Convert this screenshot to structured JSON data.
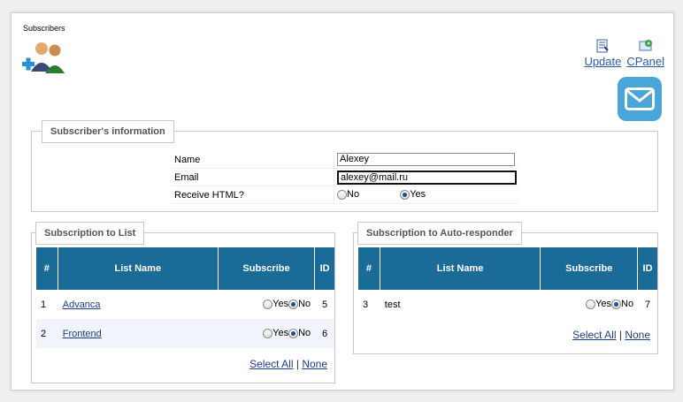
{
  "page": {
    "title": "Subscribers"
  },
  "toolbar": {
    "update_label": "Update",
    "cpanel_label": "CPanel"
  },
  "info": {
    "legend": "Subscriber's information",
    "name_label": "Name",
    "name_value": "Alexey",
    "email_label": "Email",
    "email_value": "alexey@mail.ru",
    "html_label": "Receive HTML?",
    "no_label": "No",
    "yes_label": "Yes",
    "html_selected": "Yes"
  },
  "lists": {
    "legend": "Subscription to List",
    "headers": [
      "#",
      "List Name",
      "Subscribe",
      "ID"
    ],
    "rows": [
      {
        "num": "1",
        "name": "Advanca",
        "yes": "Yes",
        "no": "No",
        "selected": "No",
        "id": "5"
      },
      {
        "num": "2",
        "name": "Frontend",
        "yes": "Yes",
        "no": "No",
        "selected": "No",
        "id": "6"
      }
    ],
    "select_all": "Select All",
    "separator": "|",
    "none": "None"
  },
  "auto": {
    "legend": "Subscription to Auto-responder",
    "headers": [
      "#",
      "List Name",
      "Subscribe",
      "ID"
    ],
    "rows": [
      {
        "num": "3",
        "name": "test",
        "yes": "Yes",
        "no": "No",
        "selected": "No",
        "id": "7"
      }
    ],
    "select_all": "Select All",
    "separator": "|",
    "none": "None"
  },
  "colors": {
    "header_bg": "#1a6b98",
    "link": "#1c3d8c",
    "mail_badge": "#4aa6d8"
  }
}
